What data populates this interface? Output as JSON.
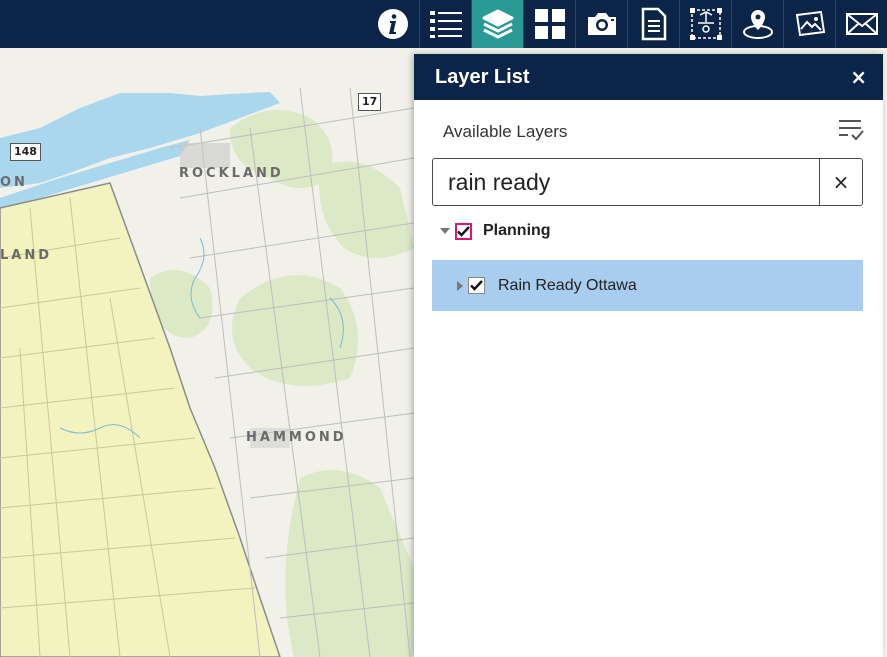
{
  "toolbar": {
    "tools": [
      {
        "icon": "info-icon"
      },
      {
        "icon": "legend-list-icon"
      },
      {
        "icon": "layers-icon",
        "active": true
      },
      {
        "icon": "basemap-gallery-icon"
      },
      {
        "icon": "camera-icon"
      },
      {
        "icon": "document-icon"
      },
      {
        "icon": "draw-icon"
      },
      {
        "icon": "location-icon"
      },
      {
        "icon": "image-gallery-icon"
      },
      {
        "icon": "mail-icon"
      }
    ],
    "active_color": "#2a9a97",
    "bar_color": "#0b2447"
  },
  "map": {
    "labels": {
      "rockland": "ROCKLAND",
      "hammond": "HAMMOND",
      "on": "ON",
      "land": "LAND"
    },
    "shields": {
      "hwy17": "17",
      "hwy148": "148"
    }
  },
  "layer_list": {
    "title": "Layer List",
    "close": "×",
    "available_layers": "Available Layers",
    "search": {
      "value": "rain ready",
      "clear": "×"
    },
    "groups": [
      {
        "label": "Planning",
        "checked": true,
        "layers": [
          {
            "label": "Rain Ready Ottawa",
            "checked": true,
            "highlight": "#a8cdee"
          }
        ]
      }
    ]
  }
}
